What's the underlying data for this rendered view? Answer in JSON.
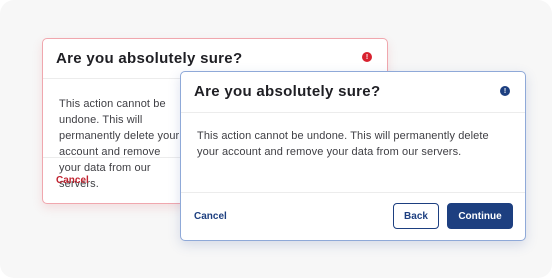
{
  "danger_dialog": {
    "title": "Are you absolutely sure?",
    "icon": "alert-icon",
    "accent_color": "#d8222f",
    "body": "This action cannot be undone. This will permanently delete your account and remove your data from our servers.",
    "cancel_label": "Cancel"
  },
  "primary_dialog": {
    "title": "Are you absolutely sure?",
    "icon": "alert-icon",
    "accent_color": "#1d3f80",
    "body": "This action cannot be undone. This will permanently delete your account and remove your data from our servers.",
    "cancel_label": "Cancel",
    "back_label": "Back",
    "continue_label": "Continue"
  }
}
